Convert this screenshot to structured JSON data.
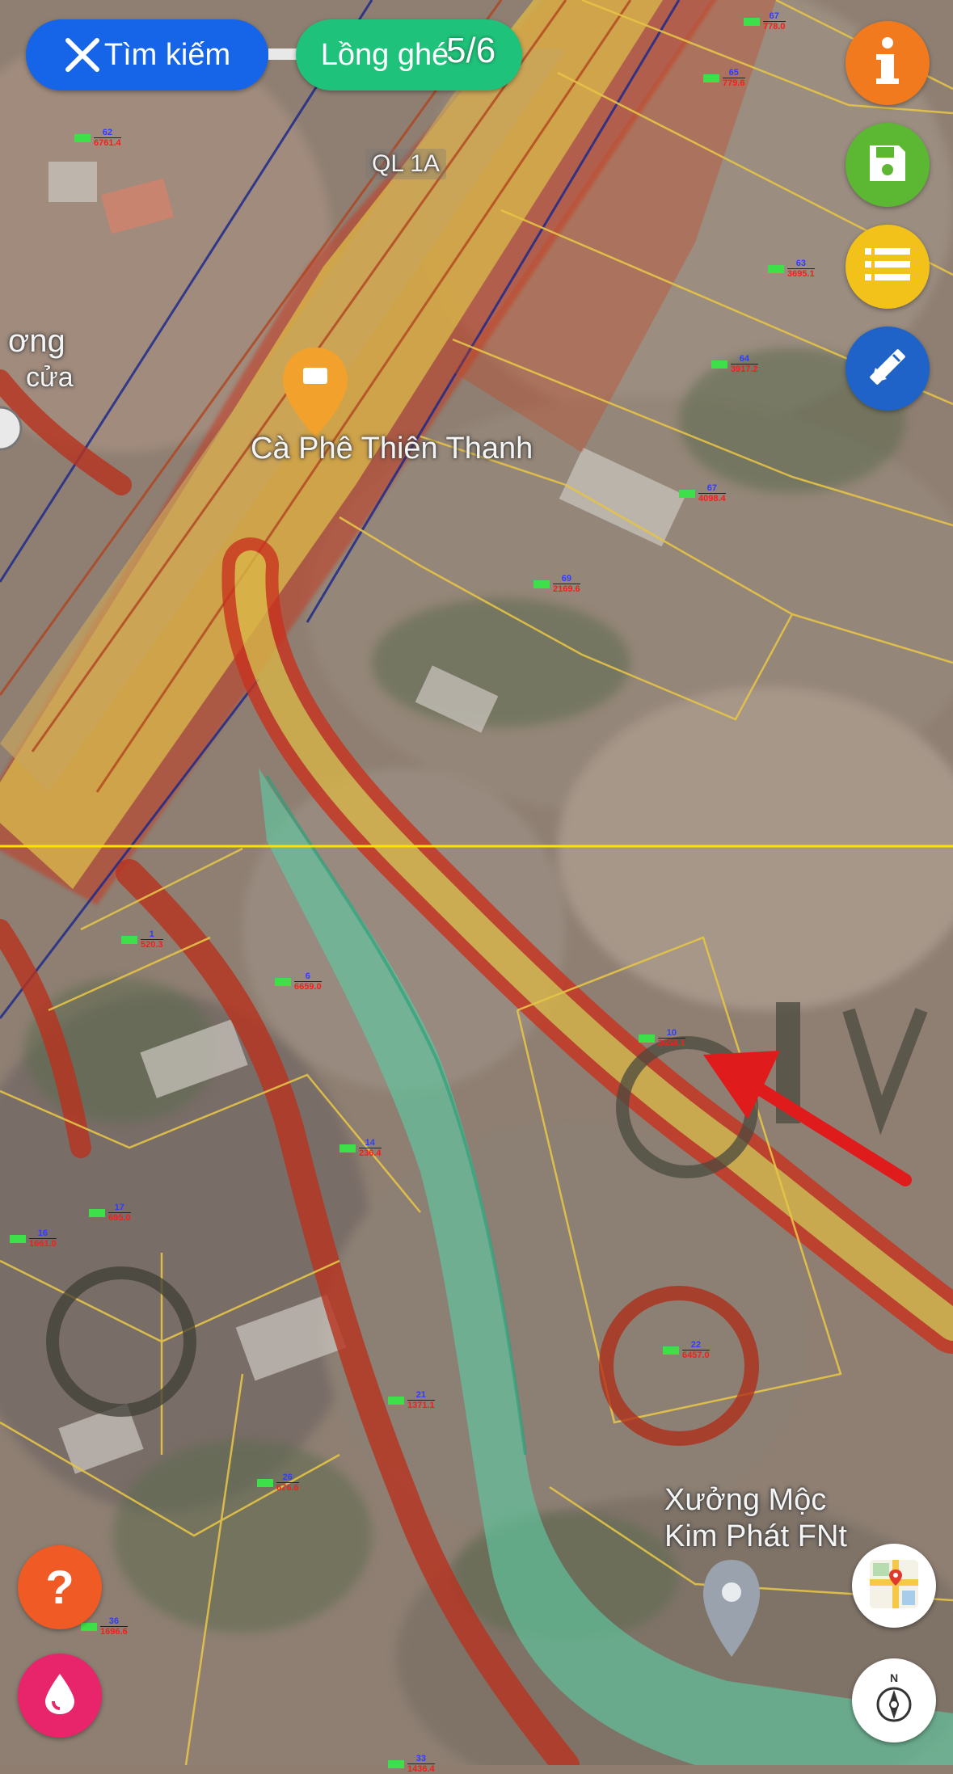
{
  "top_bar": {
    "search_label": "Tìm kiếm",
    "overlay_label": "Lồng ghé",
    "page_counter": "5/6"
  },
  "map": {
    "road_label": "QL 1A",
    "poi_cafe": "Cà Phê Thiên Thanh",
    "poi_workshop_line1": "Xưởng Mộc",
    "poi_workshop_line2": "Kim Phát FNt",
    "partial_place_line1": "ơng",
    "partial_place_line2": "cửa",
    "parcel_labels": [
      {
        "no": "62",
        "area": "6761.4"
      },
      {
        "no": "67",
        "area": "778.0"
      },
      {
        "no": "65",
        "area": "779.6"
      },
      {
        "no": "63",
        "area": "3695.1"
      },
      {
        "no": "64",
        "area": "3917.2"
      },
      {
        "no": "67",
        "area": "4098.4"
      },
      {
        "no": "69",
        "area": "2169.6"
      },
      {
        "no": "10",
        "area": "3658.1"
      },
      {
        "no": "1",
        "area": "520.3"
      },
      {
        "no": "6",
        "area": "6659.0"
      },
      {
        "no": "14",
        "area": "236.4"
      },
      {
        "no": "16",
        "area": "1661.0"
      },
      {
        "no": "17",
        "area": "695.0"
      },
      {
        "no": "22",
        "area": "6457.0"
      },
      {
        "no": "21",
        "area": "1371.1"
      },
      {
        "no": "26",
        "area": "676.6"
      },
      {
        "no": "36",
        "area": "1696.6"
      },
      {
        "no": "33",
        "area": "1436.4"
      }
    ]
  },
  "icons": {
    "close": "close-icon",
    "info": "info-icon",
    "save": "save-icon",
    "list": "list-icon",
    "edit": "pencil-ruler-icon",
    "help": "help-icon",
    "drop": "water-drop-icon",
    "map_type": "map-type-icon",
    "compass": "compass-icon"
  },
  "colors": {
    "search_pill": "#1665e8",
    "overlay_pill": "#1fc27a",
    "info_btn": "#f07a1d",
    "save_btn": "#5cb832",
    "list_btn": "#f2c21b",
    "edit_btn": "#1f63c8",
    "help_btn": "#f05a24",
    "drop_btn": "#e8246a",
    "planning_red": "#c8321e",
    "road_yellow": "#e0b93a",
    "green_zone": "#5fc8a0",
    "grid_line": "#ffe100"
  }
}
